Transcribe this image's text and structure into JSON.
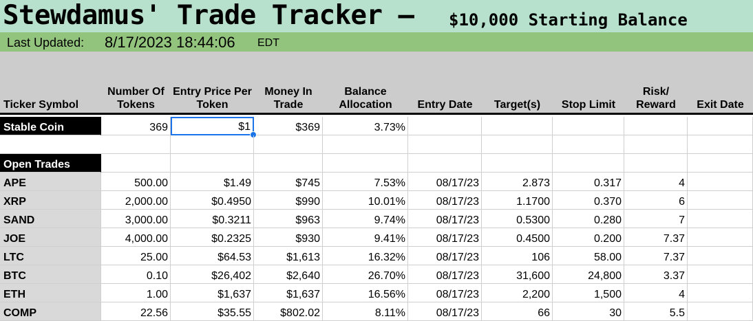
{
  "title": {
    "main": "Stewdamus' Trade Tracker –",
    "sub": "$10,000 Starting Balance"
  },
  "last_updated": {
    "label": "Last Updated:",
    "value": "8/17/2023 18:44:06",
    "timezone": "EDT"
  },
  "columns": [
    "Ticker Symbol",
    "Number Of Tokens",
    "Entry Price Per Token",
    "Money In Trade",
    "Balance Allocation",
    "Entry Date",
    "Target(s)",
    "Stop Limit",
    "Risk/ Reward",
    "Exit Date"
  ],
  "stable_coin": {
    "label": "Stable Coin",
    "tokens": "369",
    "entry_price": "$1",
    "money_in_trade": "$369",
    "allocation": "3.73%"
  },
  "open_trades_label": "Open Trades",
  "trades": [
    {
      "ticker": "APE",
      "tokens": "500.00",
      "entry_price": "$1.49",
      "money": "$745",
      "allocation": "7.53%",
      "entry_date": "08/17/23",
      "target": "2.873",
      "stop": "0.317",
      "rr": "4",
      "exit": ""
    },
    {
      "ticker": "XRP",
      "tokens": "2,000.00",
      "entry_price": "$0.4950",
      "money": "$990",
      "allocation": "10.01%",
      "entry_date": "08/17/23",
      "target": "1.1700",
      "stop": "0.370",
      "rr": "6",
      "exit": ""
    },
    {
      "ticker": "SAND",
      "tokens": "3,000.00",
      "entry_price": "$0.3211",
      "money": "$963",
      "allocation": "9.74%",
      "entry_date": "08/17/23",
      "target": "0.5300",
      "stop": "0.280",
      "rr": "7",
      "exit": ""
    },
    {
      "ticker": "JOE",
      "tokens": "4,000.00",
      "entry_price": "$0.2325",
      "money": "$930",
      "allocation": "9.41%",
      "entry_date": "08/17/23",
      "target": "0.4500",
      "stop": "0.200",
      "rr": "7.37",
      "exit": ""
    },
    {
      "ticker": "LTC",
      "tokens": "25.00",
      "entry_price": "$64.53",
      "money": "$1,613",
      "allocation": "16.32%",
      "entry_date": "08/17/23",
      "target": "106",
      "stop": "58.00",
      "rr": "7.37",
      "exit": ""
    },
    {
      "ticker": "BTC",
      "tokens": "0.10",
      "entry_price": "$26,402",
      "money": "$2,640",
      "allocation": "26.70%",
      "entry_date": "08/17/23",
      "target": "31,600",
      "stop": "24,800",
      "rr": "3.37",
      "exit": ""
    },
    {
      "ticker": "ETH",
      "tokens": "1.00",
      "entry_price": "$1,637",
      "money": "$1,637",
      "allocation": "16.56%",
      "entry_date": "08/17/23",
      "target": "2,200",
      "stop": "1,500",
      "rr": "4",
      "exit": ""
    },
    {
      "ticker": "COMP",
      "tokens": "22.56",
      "entry_price": "$35.55",
      "money": "$802.02",
      "allocation": "8.11%",
      "entry_date": "08/17/23",
      "target": "66",
      "stop": "30",
      "rr": "5.5",
      "exit": ""
    }
  ],
  "colors": {
    "title_bg": "#b7e1cd",
    "updated_bg": "#93c47d",
    "header_bg": "#cccccc",
    "selection": "#1a73e8"
  }
}
